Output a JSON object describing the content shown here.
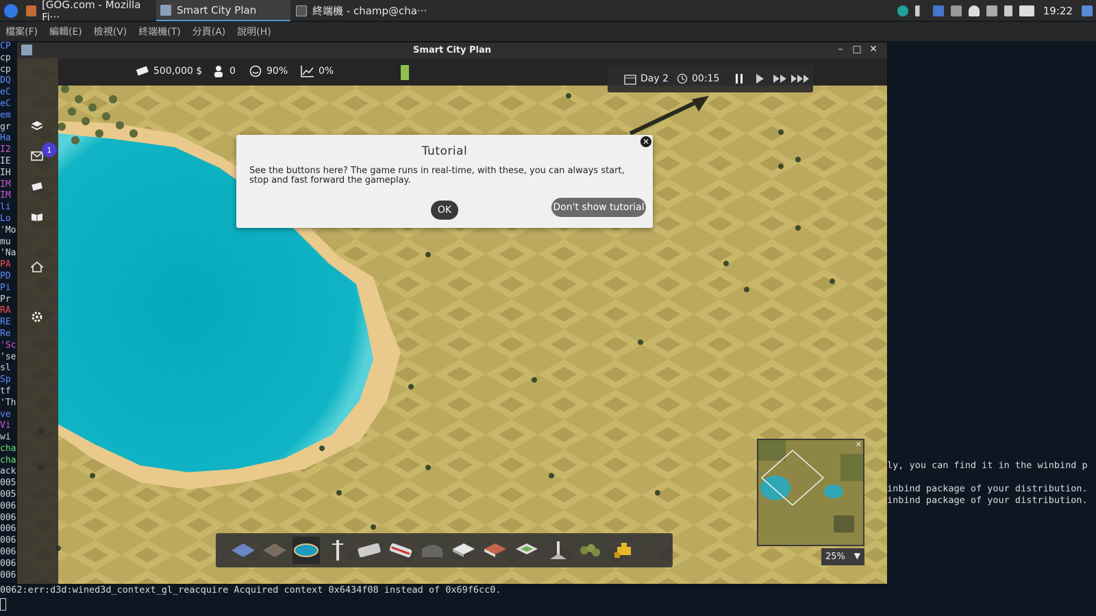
{
  "taskbar": {
    "tabs": [
      {
        "label": "[GOG.com - Mozilla Fi···",
        "icon": "firefox-icon"
      },
      {
        "label": "Smart City Plan",
        "icon": "game-icon"
      },
      {
        "label": "終端機 - champ@cha···",
        "icon": "terminal-icon"
      }
    ],
    "clock": "19:22"
  },
  "terminal": {
    "menu": [
      "檔案(F)",
      "編輯(E)",
      "檢視(V)",
      "終端機(T)",
      "分頁(A)",
      "說明(H)"
    ],
    "left_lines": [
      {
        "t": "CP",
        "c": "c-blue"
      },
      {
        "t": "cp",
        "c": "c-wht"
      },
      {
        "t": "cp",
        "c": "c-wht"
      },
      {
        "t": "DQ",
        "c": "c-blue"
      },
      {
        "t": "eC",
        "c": "c-blue"
      },
      {
        "t": "eC",
        "c": "c-blue"
      },
      {
        "t": "em",
        "c": "c-blue"
      },
      {
        "t": "gr",
        "c": "c-wht"
      },
      {
        "t": "Ha",
        "c": "c-blue"
      },
      {
        "t": "I2",
        "c": "c-mag"
      },
      {
        "t": "IE",
        "c": "c-wht"
      },
      {
        "t": "IH",
        "c": "c-wht"
      },
      {
        "t": "IM",
        "c": "c-mag"
      },
      {
        "t": "IM",
        "c": "c-mag"
      },
      {
        "t": "li",
        "c": "c-blue"
      },
      {
        "t": "Lo",
        "c": "c-blue"
      },
      {
        "t": "'Mo",
        "c": "c-wht"
      },
      {
        "t": "mu",
        "c": "c-wht"
      },
      {
        "t": "'Na",
        "c": "c-wht"
      },
      {
        "t": "PA",
        "c": "c-red"
      },
      {
        "t": "PD",
        "c": "c-blue"
      },
      {
        "t": "Pi",
        "c": "c-blue"
      },
      {
        "t": "Pr",
        "c": "c-wht"
      },
      {
        "t": "RA",
        "c": "c-red"
      },
      {
        "t": "RE",
        "c": "c-blue"
      },
      {
        "t": "Re",
        "c": "c-blue"
      },
      {
        "t": "'Sc",
        "c": "c-mag"
      },
      {
        "t": "'se",
        "c": "c-wht"
      },
      {
        "t": "sl",
        "c": "c-wht"
      },
      {
        "t": "Sp",
        "c": "c-blue"
      },
      {
        "t": "tf",
        "c": "c-wht"
      },
      {
        "t": "'Th",
        "c": "c-wht"
      },
      {
        "t": "ve",
        "c": "c-blue"
      },
      {
        "t": "Vi",
        "c": "c-mag"
      },
      {
        "t": "wi",
        "c": "c-wht"
      },
      {
        "t": "cha",
        "c": "c-grn"
      },
      {
        "t": "cha",
        "c": "c-grn"
      },
      {
        "t": "ack",
        "c": "c-wht"
      },
      {
        "t": "005",
        "c": "c-wht"
      },
      {
        "t": "005",
        "c": "c-wht"
      },
      {
        "t": "006",
        "c": "c-wht"
      },
      {
        "t": "006",
        "c": "c-wht"
      },
      {
        "t": "006",
        "c": "c-wht"
      },
      {
        "t": "006",
        "c": "c-wht"
      },
      {
        "t": "006",
        "c": "c-wht"
      },
      {
        "t": "006",
        "c": "c-wht"
      },
      {
        "t": "006",
        "c": "c-wht"
      }
    ],
    "right_lines": [
      "ly, you can find it in the winbind p",
      "",
      "inbind package of your distribution.",
      "inbind package of your distribution."
    ],
    "bottom_line": "0062:err:d3d:wined3d_context_gl_reacquire Acquired context 0x6434f08 instead of 0x69f6cc0."
  },
  "game": {
    "window_title": "Smart City Plan",
    "stats": {
      "money": "500,000 $",
      "population": "0",
      "happiness": "90%",
      "growth": "0%"
    },
    "time": {
      "day": "Day 2",
      "clock": "00:15"
    },
    "sidebar_badge": "1",
    "tutorial": {
      "title": "Tutorial",
      "message": "See the buttons here? The game runs in real-time, with these, you can always start, stop and fast forward the gameplay.",
      "ok": "OK",
      "dont_show": "Don't show tutorial"
    },
    "build_tools": [
      "terrain-tool",
      "road-tool",
      "water-tool",
      "powerline-tool",
      "bus-tool",
      "train-tool",
      "tunnel-tool",
      "factory-tool",
      "house-tool",
      "stadium-tool",
      "tower-tool",
      "trees-tool",
      "bulldozer-tool"
    ],
    "zoom": "25%",
    "colors": {
      "sand_light": "#c9b766",
      "sand_dark": "#b3a055",
      "water": "#0fb0c0",
      "beach": "#f0cf95"
    }
  }
}
